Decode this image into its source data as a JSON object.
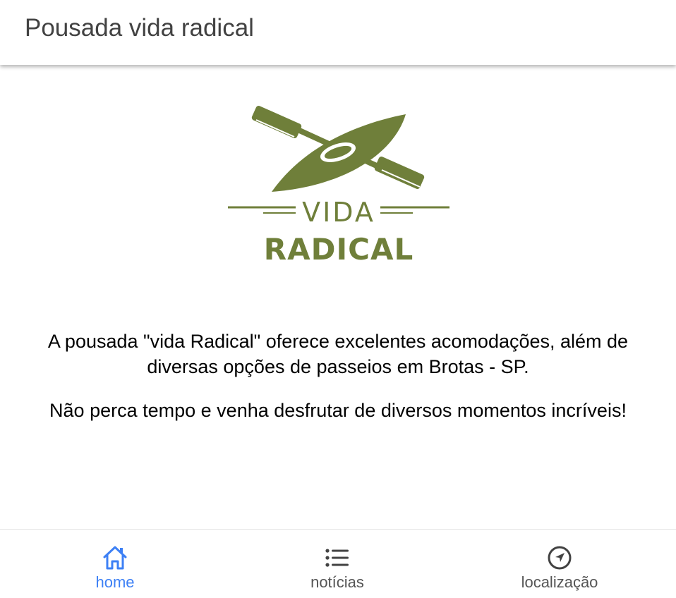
{
  "header": {
    "title": "Pousada vida radical"
  },
  "logo": {
    "line1": "VIDA",
    "line2": "RADICAL",
    "color": "#6f7f3a"
  },
  "content": {
    "paragraph1_line1": "A pousada \"vida Radical\" oferece excelentes acomodações, além de",
    "paragraph1_line2": "diversas opções de passeios em Brotas - SP.",
    "paragraph2": "Não perca tempo e venha desfrutar de diversos momentos incríveis!"
  },
  "bottom_nav": {
    "active_color": "#3d80f5",
    "inactive_color": "#555555",
    "items": [
      {
        "label": "home",
        "icon": "home-icon",
        "active": true
      },
      {
        "label": "notícias",
        "icon": "list-icon",
        "active": false
      },
      {
        "label": "localização",
        "icon": "navigation-icon",
        "active": false
      }
    ]
  }
}
